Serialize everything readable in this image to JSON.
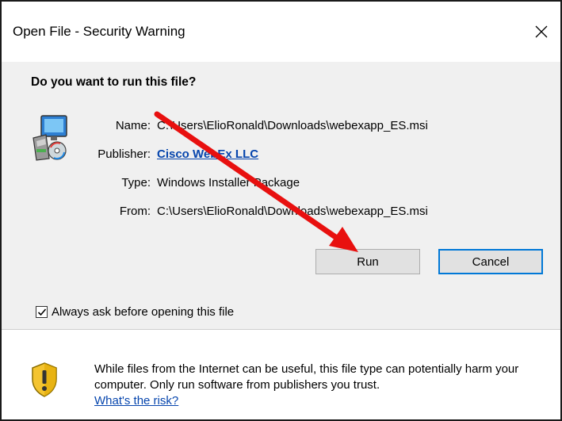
{
  "window": {
    "title": "Open File - Security Warning",
    "close_glyph": "✕"
  },
  "main": {
    "question": "Do you want to run this file?",
    "icon": "installer-package-icon",
    "fields": {
      "name": {
        "label": "Name:",
        "value": "C:\\Users\\ElioRonald\\Downloads\\webexapp_ES.msi"
      },
      "publisher": {
        "label": "Publisher:",
        "value": "Cisco WebEx LLC"
      },
      "type": {
        "label": "Type:",
        "value": "Windows Installer Package"
      },
      "from": {
        "label": "From:",
        "value": "C:\\Users\\ElioRonald\\Downloads\\webexapp_ES.msi"
      }
    },
    "buttons": {
      "run": "Run",
      "cancel": "Cancel"
    },
    "checkbox": {
      "label": "Always ask before opening this file",
      "checked": true
    }
  },
  "footer": {
    "icon": "shield-warning-icon",
    "warning": "While files from the Internet can be useful, this file type can potentially harm your computer. Only run software from publishers you trust.",
    "risk_link": "What's the risk?"
  },
  "annotation": {
    "arrow_color": "#e8100f"
  },
  "colors": {
    "link": "#0645ad",
    "default_button_border": "#0078d7",
    "content_bg": "#f0f0f0"
  }
}
